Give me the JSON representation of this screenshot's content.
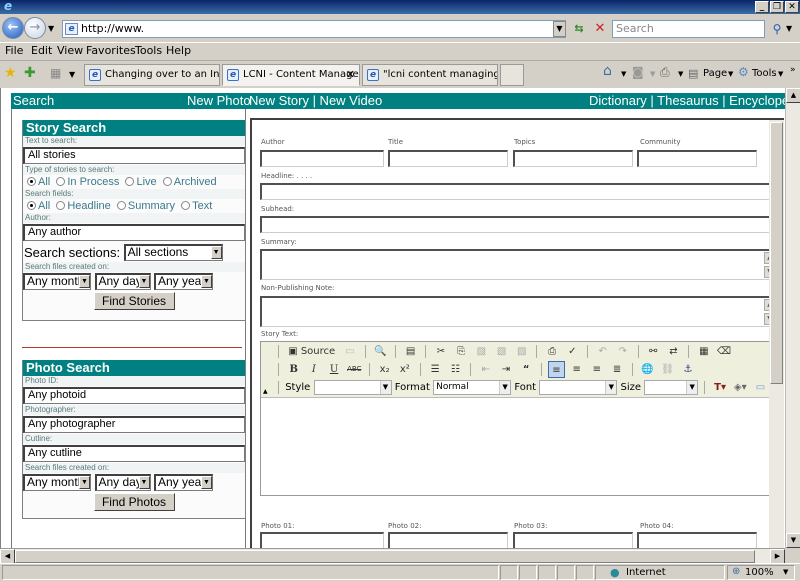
{
  "browser": {
    "window_buttons": {
      "minimize": "_",
      "restore": "❐",
      "close": "✕"
    },
    "address": "http://www.",
    "search_placeholder": "Search",
    "menu": [
      "File",
      "Edit",
      "View",
      "Favorites",
      "Tools",
      "Help"
    ],
    "tabs": [
      {
        "label": "Changing over to an Interne...",
        "active": false
      },
      {
        "label": "LCNI - Content Managem...",
        "active": true
      },
      {
        "label": "\"lcni content managing syste...",
        "active": false
      }
    ],
    "commands": {
      "page": "Page",
      "tools": "Tools",
      "more": "»"
    },
    "status": {
      "zone": "Internet",
      "zoom": "100%"
    }
  },
  "nav": {
    "search": "Search",
    "new_photo": "New Photo",
    "new_story_video": "New Story | New Video",
    "references": "Dictionary | Thesaurus | Encyclopedia"
  },
  "story_search": {
    "title": "Story Search",
    "text_label": "Text to search:",
    "text_value": "All stories",
    "type_label": "Type of stories to search:",
    "type_options": [
      {
        "label": "All",
        "checked": true
      },
      {
        "label": "In Process",
        "checked": false
      },
      {
        "label": "Live",
        "checked": false
      },
      {
        "label": "Archived",
        "checked": false
      }
    ],
    "fields_label": "Search fields:",
    "field_options": [
      {
        "label": "All",
        "checked": true
      },
      {
        "label": "Headline",
        "checked": false
      },
      {
        "label": "Summary",
        "checked": false
      },
      {
        "label": "Text",
        "checked": false
      }
    ],
    "author_label": "Author:",
    "author_value": "Any author",
    "sections_label": "Search sections:",
    "sections_value": "All sections",
    "created_label": "Search files created on:",
    "month": "Any month",
    "day": "Any day",
    "year": "Any year",
    "button": "Find Stories"
  },
  "photo_search": {
    "title": "Photo Search",
    "id_label": "Photo ID:",
    "id_value": "Any photoid",
    "photographer_label": "Photographer:",
    "photographer_value": "Any photographer",
    "cutline_label": "Cutline:",
    "cutline_value": "Any cutline",
    "created_label": "Search files created on:",
    "month": "Any month",
    "day": "Any day",
    "year": "Any year",
    "button": "Find Photos"
  },
  "story_form": {
    "author_label": "Author",
    "title_label": "Title",
    "topics_label": "Topics",
    "community_label": "Community",
    "headline_label": "Headline: . . . .",
    "subhead_label": "Subhead:",
    "summary_label": "Summary:",
    "note_label": "Non-Publishing Note:",
    "story_text_label": "Story Text:",
    "photo_labels": [
      "Photo 01:",
      "Photo 02:",
      "Photo 03:",
      "Photo 04:"
    ]
  },
  "editor": {
    "source": "Source",
    "style_label": "Style",
    "style_value": "",
    "format_label": "Format",
    "format_value": "Normal",
    "font_label": "Font",
    "font_value": "",
    "size_label": "Size",
    "size_value": ""
  }
}
